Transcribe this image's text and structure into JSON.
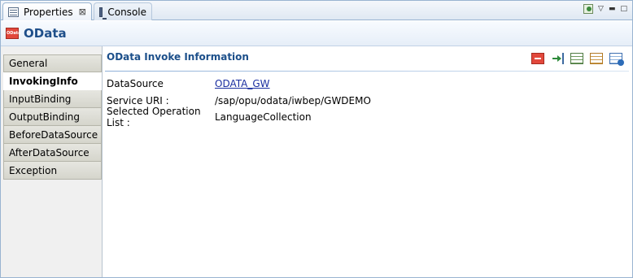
{
  "tabs": {
    "properties": "Properties",
    "console": "Console",
    "close_glyph": "⊠"
  },
  "title": "OData",
  "title_icon_text": "OData",
  "left_tabs": [
    "General",
    "InvokingInfo",
    "InputBinding",
    "OutputBinding",
    "BeforeDataSource",
    "AfterDataSource",
    "Exception"
  ],
  "selected_tab": "InvokingInfo",
  "section": {
    "title": "OData Invoke Information"
  },
  "fields": {
    "datasource_label": "DataSource",
    "datasource_value": "ODATA_GW",
    "service_uri_label": "Service URI :",
    "service_uri_value": "/sap/opu/odata/iwbep/GWDEMO",
    "operation_label": "Selected Operation List :",
    "operation_value": "LanguageCollection"
  },
  "colors": {
    "accent": "#1c4f8a",
    "title": "#1f4f8a",
    "odata_red": "#e2483c",
    "link": "#1a2ea0"
  },
  "icons": [
    "properties-icon",
    "console-icon",
    "pin-icon",
    "view-menu-icon",
    "minimize-icon",
    "maximize-icon",
    "odata-icon",
    "odata-action-icon",
    "import-icon",
    "table-green-icon",
    "table-orange-icon",
    "table-run-icon"
  ]
}
